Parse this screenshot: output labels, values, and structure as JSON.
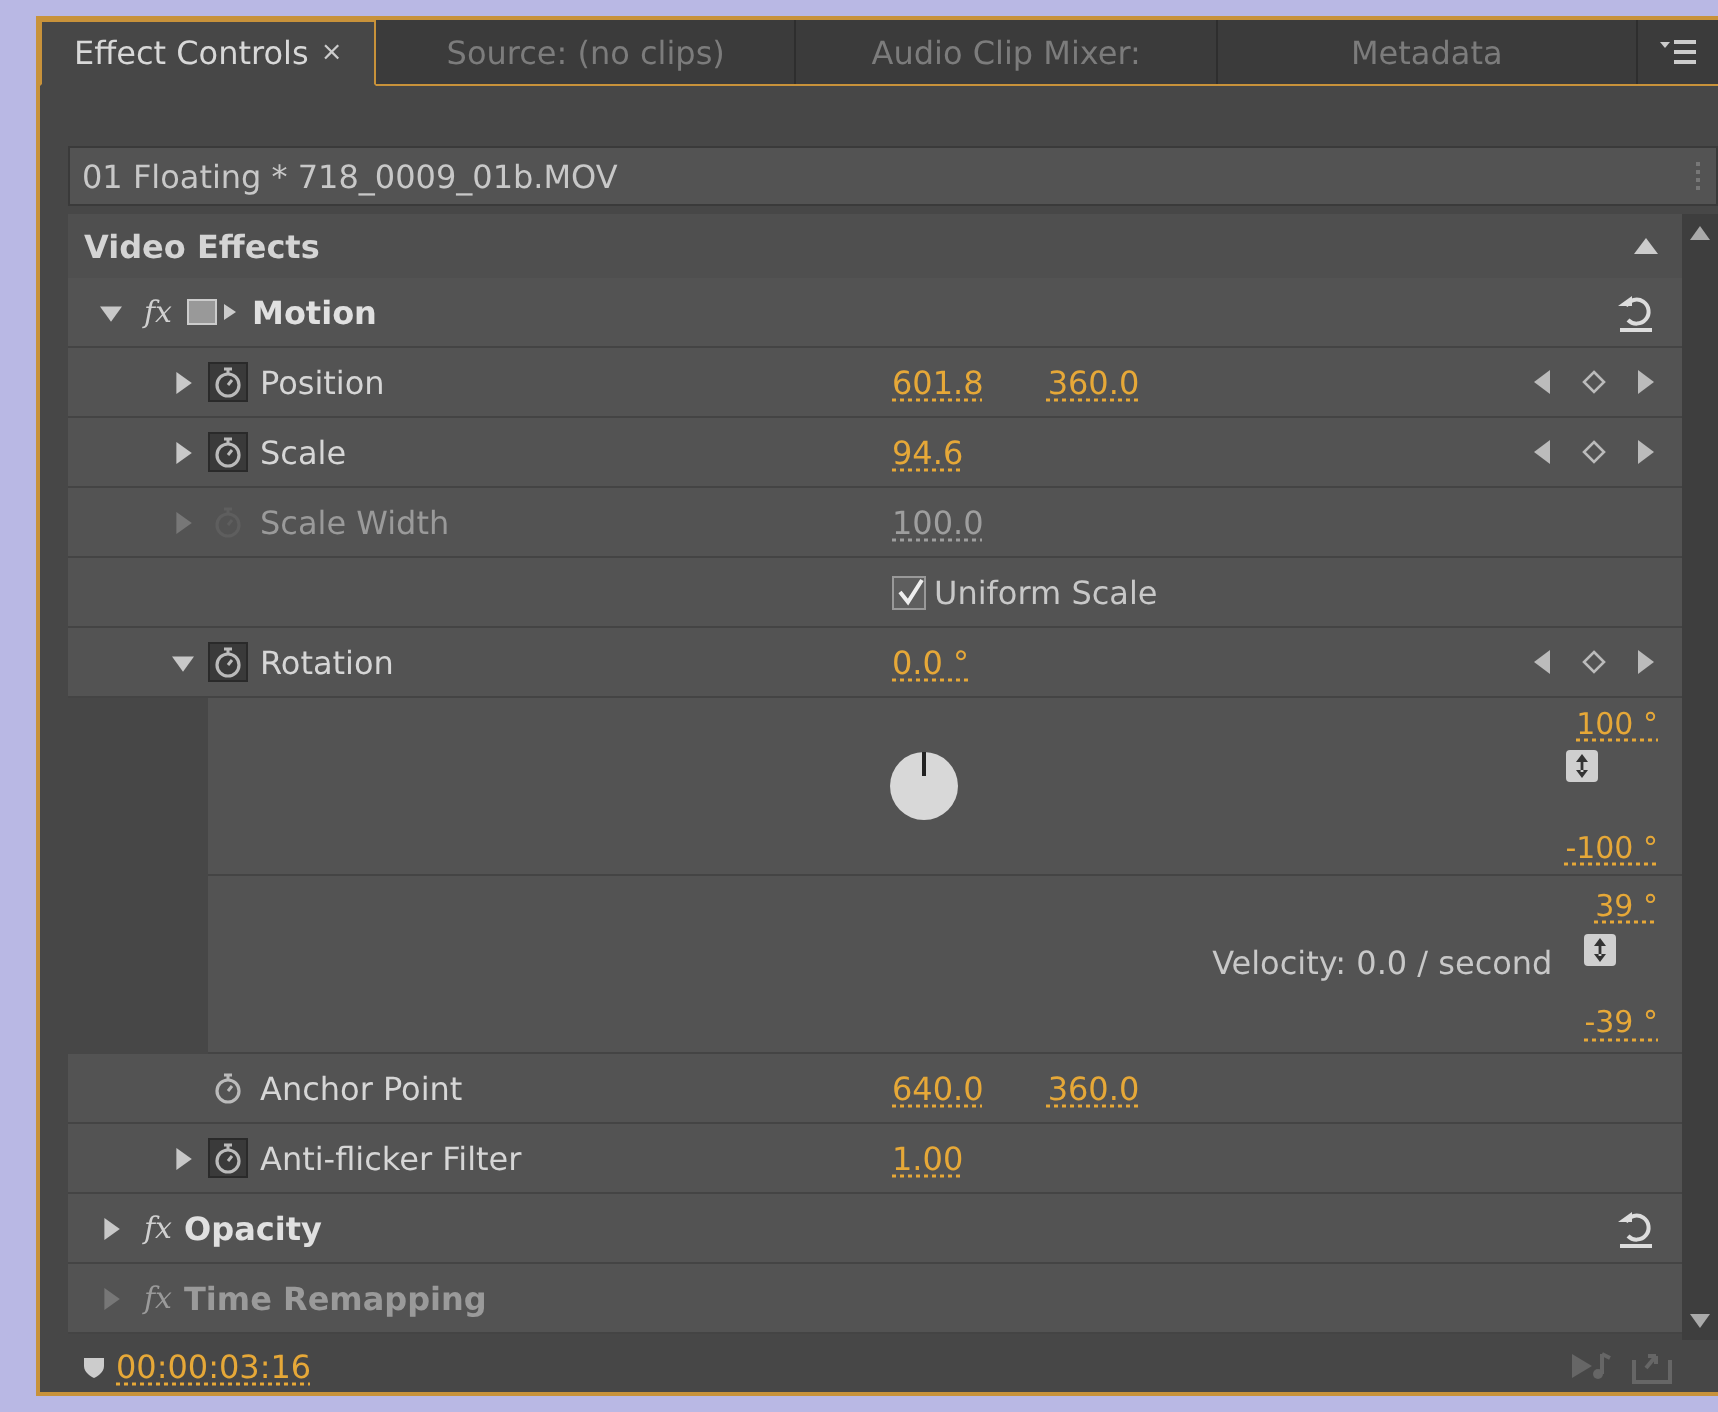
{
  "tabs": [
    {
      "label": "Effect Controls",
      "selected": true,
      "close": "×"
    },
    {
      "label": "Source: (no clips)",
      "selected": false
    },
    {
      "label": "Audio Clip Mixer:",
      "selected": false
    },
    {
      "label": "Metadata",
      "selected": false
    }
  ],
  "clip_header": "01 Floating * 718_0009_01b.MOV",
  "section_title": "Video Effects",
  "effects": [
    {
      "name": "Motion",
      "fx": "fx",
      "expanded": true,
      "disabled": false,
      "motion_icon": true,
      "properties": [
        {
          "kind": "param",
          "name": "Position",
          "expandable": true,
          "expanded": false,
          "disabled": false,
          "values": [
            "601.8",
            "360.0"
          ],
          "keyframes": true
        },
        {
          "kind": "param",
          "name": "Scale",
          "expandable": true,
          "expanded": false,
          "disabled": false,
          "values": [
            "94.6"
          ],
          "keyframes": true
        },
        {
          "kind": "param",
          "name": "Scale Width",
          "expandable": true,
          "expanded": false,
          "disabled": true,
          "values": [
            "100.0"
          ],
          "keyframes": false
        },
        {
          "kind": "checkbox",
          "label": "Uniform Scale",
          "checked": true
        },
        {
          "kind": "param",
          "name": "Rotation",
          "expandable": true,
          "expanded": true,
          "disabled": false,
          "values": [
            "0.0 °"
          ],
          "keyframes": true
        },
        {
          "kind": "dial_graph",
          "max": "100 °",
          "min": "-100 °"
        },
        {
          "kind": "velocity_graph",
          "max": "39 °",
          "label": "Velocity: 0.0 / second",
          "min": "-39 °"
        },
        {
          "kind": "param",
          "name": "Anchor Point",
          "expandable": false,
          "disabled": false,
          "values": [
            "640.0",
            "360.0"
          ],
          "keyframes": false
        },
        {
          "kind": "param",
          "name": "Anti-flicker Filter",
          "expandable": true,
          "expanded": false,
          "disabled": false,
          "values": [
            "1.00"
          ],
          "keyframes": false
        }
      ]
    },
    {
      "name": "Opacity",
      "fx": "fx",
      "expanded": false,
      "disabled": false,
      "motion_icon": false
    },
    {
      "name": "Time Remapping",
      "fx": "fx",
      "expanded": false,
      "disabled": true,
      "motion_icon": false
    }
  ],
  "timecode": "00:00:03:16"
}
